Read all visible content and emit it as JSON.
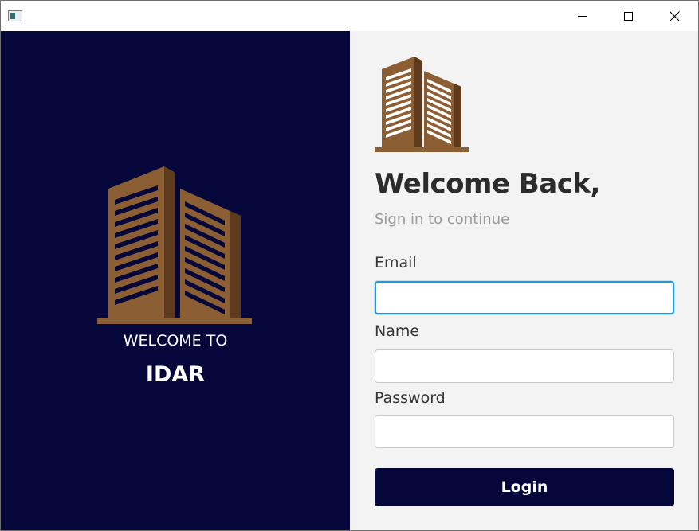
{
  "window": {
    "controls": {
      "minimize_icon": "minimize-icon",
      "maximize_icon": "maximize-icon",
      "close_icon": "close-icon"
    }
  },
  "left_panel": {
    "welcome_text": "WELCOME TO",
    "brand_name": "IDAR",
    "background_color": "#05063a",
    "logo_icon": "building-logo-icon"
  },
  "right_panel": {
    "logo_icon": "building-logo-icon",
    "heading": "Welcome Back,",
    "subheading": "Sign in to continue",
    "background_color": "#f3f3f3"
  },
  "form": {
    "email_label": "Email",
    "email_value": "",
    "name_label": "Name",
    "name_value": "",
    "password_label": "Password",
    "password_value": "",
    "login_label": "Login",
    "focus_color": "#1e9ae0"
  },
  "colors": {
    "logo_brown": "#8b5e34",
    "logo_dark": "#5e3b1d",
    "button_bg": "#05063a"
  }
}
